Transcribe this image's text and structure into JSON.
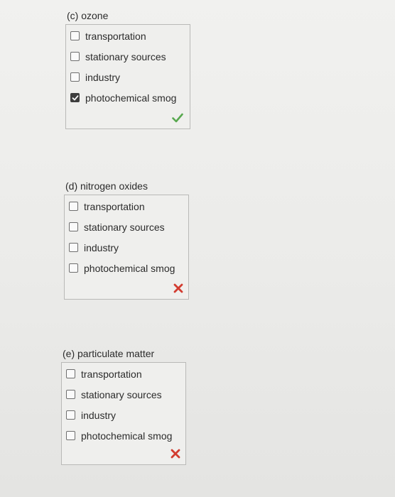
{
  "colors": {
    "correct": "#58a84f",
    "incorrect": "#d23c30"
  },
  "questions": [
    {
      "title": "(c) ozone",
      "options": [
        {
          "label": "transportation",
          "checked": false
        },
        {
          "label": "stationary sources",
          "checked": false
        },
        {
          "label": "industry",
          "checked": false
        },
        {
          "label": "photochemical smog",
          "checked": true
        }
      ],
      "result_icon": "checkmark-icon"
    },
    {
      "title": "(d) nitrogen oxides",
      "options": [
        {
          "label": "transportation",
          "checked": false
        },
        {
          "label": "stationary sources",
          "checked": false
        },
        {
          "label": "industry",
          "checked": false
        },
        {
          "label": "photochemical smog",
          "checked": false
        }
      ],
      "result_icon": "x-mark-icon"
    },
    {
      "title": "(e) particulate matter",
      "options": [
        {
          "label": "transportation",
          "checked": false
        },
        {
          "label": "stationary sources",
          "checked": false
        },
        {
          "label": "industry",
          "checked": false
        },
        {
          "label": "photochemical smog",
          "checked": false
        }
      ],
      "result_icon": "x-mark-icon"
    }
  ]
}
